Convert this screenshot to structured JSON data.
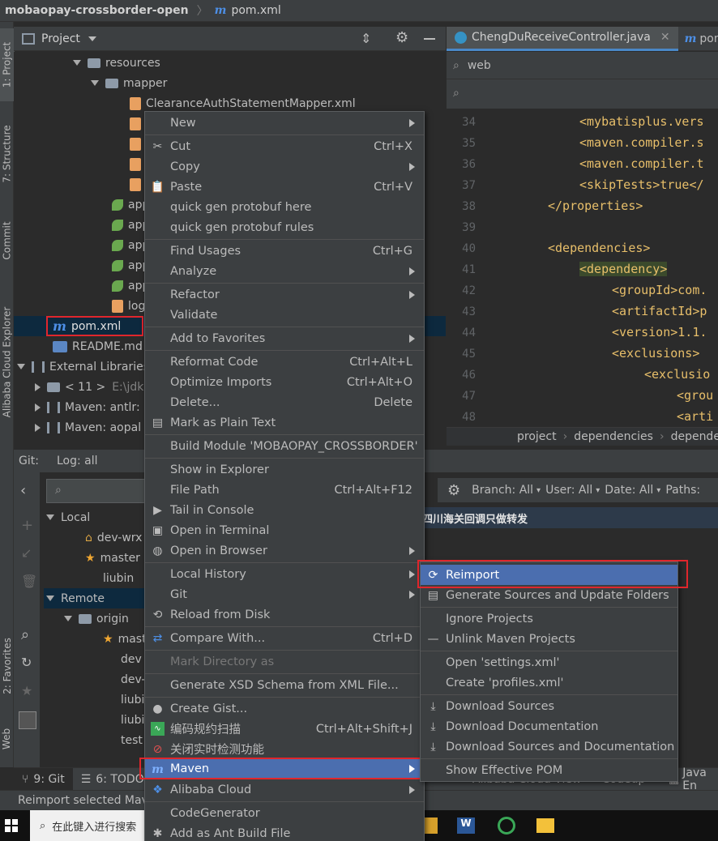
{
  "titlebar": {
    "project_name": "mobaopay-crossborder-open",
    "file_name": "pom.xml"
  },
  "left_strip": {
    "project_tab": "1: Project",
    "structure_tab": "7: Structure",
    "commit_tab": "Commit",
    "alibaba_tab": "Alibaba Cloud Explorer",
    "favorites_tab": "2: Favorites",
    "web_tab": "Web"
  },
  "project_panel": {
    "title": "Project",
    "tree": [
      {
        "label": "resources"
      },
      {
        "label": "mapper"
      },
      {
        "label": "ClearanceAuthStatementMapper.xml"
      },
      {
        "label": "app"
      },
      {
        "label": "app"
      },
      {
        "label": "app"
      },
      {
        "label": "app"
      },
      {
        "label": "app"
      },
      {
        "label": "log"
      },
      {
        "label": "pom.xml"
      },
      {
        "label": "README.md"
      },
      {
        "label": "External Libraries"
      },
      {
        "label": "< 11 >",
        "extra": "E:\\jdk"
      },
      {
        "label": "Maven: antlr:"
      },
      {
        "label": "Maven: aopal"
      }
    ]
  },
  "editor": {
    "tab_active": "ChengDuReceiveController.java",
    "tab_next": "pom",
    "search_value": "web",
    "lines": [
      {
        "num": "34",
        "text": "<mybatisplus.vers"
      },
      {
        "num": "35",
        "text": "<maven.compiler.s"
      },
      {
        "num": "36",
        "text": "<maven.compiler.t"
      },
      {
        "num": "37",
        "text": "<skipTests>true</"
      },
      {
        "num": "38",
        "text": "</properties>"
      },
      {
        "num": "39",
        "text": ""
      },
      {
        "num": "40",
        "text": "<dependencies>"
      },
      {
        "num": "41",
        "text": "<dependency>"
      },
      {
        "num": "42",
        "text": "<groupId>com."
      },
      {
        "num": "43",
        "text": "<artifactId>p"
      },
      {
        "num": "44",
        "text": "<version>1.1."
      },
      {
        "num": "45",
        "text": "<exclusions>"
      },
      {
        "num": "46",
        "text": "<exclusio"
      },
      {
        "num": "47",
        "text": "<grou"
      },
      {
        "num": "48",
        "text": "<arti"
      }
    ],
    "breadcrumbs": [
      "project",
      "dependencies",
      "depende"
    ]
  },
  "git": {
    "tab_git": "Git:",
    "tab_log": "Log: all",
    "branch_filter": "Branch: All",
    "user_filter": "User: All",
    "date_filter": "Date: All",
    "paths_filter": "Paths:",
    "commit_message": "四川海关回调只做转发",
    "tree": [
      {
        "label": "Local"
      },
      {
        "label": "dev-wrx"
      },
      {
        "label": "master"
      },
      {
        "label": "liubin"
      },
      {
        "label": "Remote"
      },
      {
        "label": "origin"
      },
      {
        "label": "mast"
      },
      {
        "label": "dev"
      },
      {
        "label": "dev-"
      },
      {
        "label": "liubi"
      },
      {
        "label": "liubi"
      },
      {
        "label": "test"
      }
    ]
  },
  "bottom_tabs": {
    "git": "9: Git",
    "todo": "6: TODO",
    "alibaba": "Alibaba Cloud View",
    "codeup": "Codeup",
    "java": "Java En"
  },
  "status_text": "Reimport selected Mave",
  "taskbar": {
    "search_placeholder": "在此键入进行搜索"
  },
  "context_menu": {
    "items": [
      {
        "label": "New",
        "submenu": true
      },
      {
        "label": "Cut",
        "shortcut": "Ctrl+X"
      },
      {
        "label": "Copy",
        "submenu": true
      },
      {
        "label": "Paste",
        "shortcut": "Ctrl+V"
      },
      {
        "label": "quick gen protobuf here"
      },
      {
        "label": "quick gen protobuf rules"
      },
      {
        "label": "Find Usages",
        "shortcut": "Ctrl+G"
      },
      {
        "label": "Analyze",
        "submenu": true
      },
      {
        "label": "Refactor",
        "submenu": true
      },
      {
        "label": "Validate"
      },
      {
        "label": "Add to Favorites",
        "submenu": true
      },
      {
        "label": "Reformat Code",
        "shortcut": "Ctrl+Alt+L"
      },
      {
        "label": "Optimize Imports",
        "shortcut": "Ctrl+Alt+O"
      },
      {
        "label": "Delete...",
        "shortcut": "Delete"
      },
      {
        "label": "Mark as Plain Text"
      },
      {
        "label": "Build Module 'MOBAOPAY_CROSSBORDER'"
      },
      {
        "label": "Show in Explorer"
      },
      {
        "label": "File Path",
        "shortcut": "Ctrl+Alt+F12"
      },
      {
        "label": "Tail in Console"
      },
      {
        "label": "Open in Terminal"
      },
      {
        "label": "Open in Browser",
        "submenu": true
      },
      {
        "label": "Local History",
        "submenu": true
      },
      {
        "label": "Git",
        "submenu": true
      },
      {
        "label": "Reload from Disk"
      },
      {
        "label": "Compare With...",
        "shortcut": "Ctrl+D"
      },
      {
        "label": "Mark Directory as",
        "disabled": true,
        "submenu": true
      },
      {
        "label": "Generate XSD Schema from XML File..."
      },
      {
        "label": "Create Gist..."
      },
      {
        "label": "编码规约扫描",
        "shortcut": "Ctrl+Alt+Shift+J"
      },
      {
        "label": "关闭实时检测功能"
      },
      {
        "label": "Maven",
        "submenu": true,
        "selected": true
      },
      {
        "label": "Alibaba Cloud",
        "submenu": true
      },
      {
        "label": "CodeGenerator"
      },
      {
        "label": "Add as Ant Build File"
      }
    ]
  },
  "maven_submenu": {
    "items": [
      {
        "label": "Reimport",
        "selected": true
      },
      {
        "label": "Generate Sources and Update Folders"
      },
      {
        "label": "Ignore Projects"
      },
      {
        "label": "Unlink Maven Projects"
      },
      {
        "label": "Open 'settings.xml'"
      },
      {
        "label": "Create 'profiles.xml'"
      },
      {
        "label": "Download Sources"
      },
      {
        "label": "Download Documentation"
      },
      {
        "label": "Download Sources and Documentation"
      },
      {
        "label": "Show Effective POM"
      }
    ]
  }
}
